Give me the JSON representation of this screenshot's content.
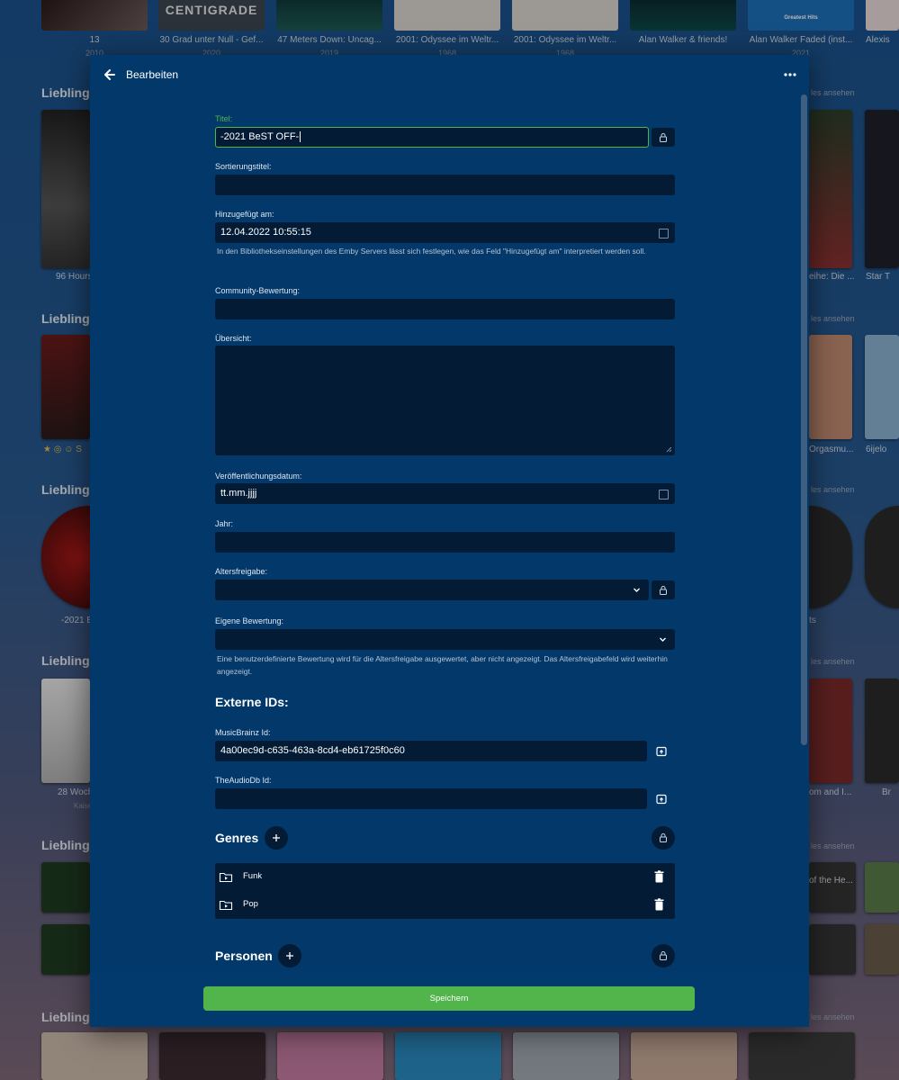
{
  "background": {
    "top_row": [
      {
        "title": "13",
        "year": "2010"
      },
      {
        "title": "30 Grad unter Null - Gef...",
        "year": "2020"
      },
      {
        "title": "47 Meters Down: Uncag...",
        "year": "2019"
      },
      {
        "title": "2001: Odyssee im Weltr...",
        "year": "1968"
      },
      {
        "title": "2001: Odyssee im Weltr...",
        "year": "1968"
      },
      {
        "title": "Alan Walker & friends!",
        "year": ""
      },
      {
        "title": "Alan Walker Faded (inst...",
        "year": "2021"
      },
      {
        "title": "Alexis",
        "year": ""
      }
    ],
    "poster_text": {
      "centigrade": "CENTIGRADE",
      "greatest_hits": "Greatest Hits"
    },
    "section_title": "Lieblings",
    "see_all": "les ansehen",
    "captions": {
      "c1": "96 Hours",
      "c2": "-2021 B",
      "c3": "28 Woch",
      "c3_sub": "Kaise",
      "r1": "eihe: Die ...",
      "r1b": "Star T",
      "r2": "Orgasmu...",
      "r2b": "6ijelo",
      "r3": "ts",
      "r4": "om and I...",
      "r4b": "Br",
      "r5": "of the He..."
    },
    "icon_row_text": "S"
  },
  "dialog": {
    "title": "Bearbeiten",
    "fields": {
      "title_label": "Titel:",
      "title_value": "-2021 BeST OFF-",
      "sort_title_label": "Sortierungstitel:",
      "sort_title_value": "",
      "date_added_label": "Hinzugefügt am:",
      "date_added_value": "12.04.2022 10:55:15",
      "date_added_hint": "In den Bibliothekseinstellungen des Emby Servers lässt sich festlegen, wie das Feld \"Hinzugefügt am\" interpretiert werden soll.",
      "community_rating_label": "Community-Bewertung:",
      "community_rating_value": "",
      "overview_label": "Übersicht:",
      "overview_value": "",
      "release_date_label": "Veröffentlichungsdatum:",
      "release_date_value": "tt.mm.jjjj",
      "year_label": "Jahr:",
      "year_value": "",
      "parental_rating_label": "Altersfreigabe:",
      "parental_rating_value": "",
      "custom_rating_label": "Eigene Bewertung:",
      "custom_rating_value": "",
      "custom_rating_hint": "Eine benutzerdefinierte Bewertung wird für die Altersfreigabe ausgewertet, aber nicht angezeigt. Das Altersfreigabefeld wird weiterhin angezeigt."
    },
    "external_ids": {
      "heading": "Externe IDs:",
      "musicbrainz_label": "MusicBrainz Id:",
      "musicbrainz_value": "4a00ec9d-c635-463a-8cd4-eb61725f0c60",
      "audiodb_label": "TheAudioDb Id:",
      "audiodb_value": ""
    },
    "genres": {
      "heading": "Genres",
      "items": [
        {
          "name": "Funk"
        },
        {
          "name": "Pop"
        }
      ]
    },
    "people": {
      "heading": "Personen"
    },
    "save_label": "Speichern"
  },
  "colors": {
    "accent": "#52b54b",
    "dialog_bg": "#02386a",
    "field_bg": "#031b35"
  }
}
